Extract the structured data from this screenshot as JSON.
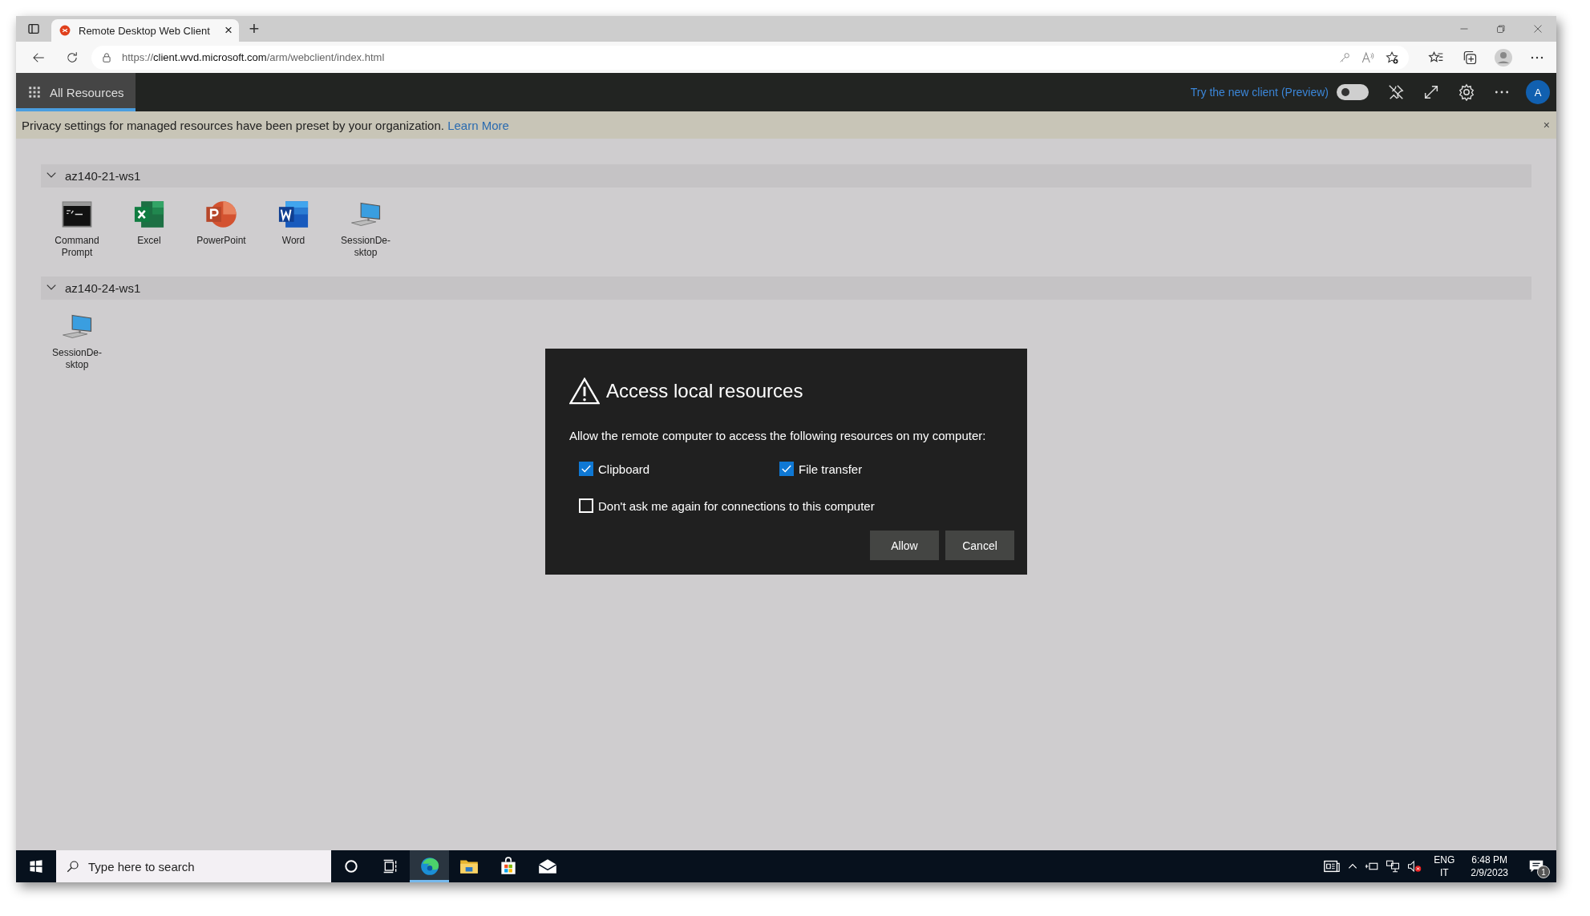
{
  "browser": {
    "tab": {
      "title": "Remote Desktop Web Client",
      "close": "×",
      "selected": true
    },
    "new_tab": "+",
    "address": {
      "scheme": "https://",
      "host": "client.wvd.microsoft.com",
      "path": "/arm/webclient/index.html"
    }
  },
  "app_bar": {
    "tabs": [
      {
        "label": "All Resources",
        "selected": true
      }
    ],
    "preview_link": "Try the new client (Preview)",
    "preview_toggle": {
      "on": false
    },
    "avatar": "A"
  },
  "banner": {
    "text": "Privacy settings for managed resources have been preset by your organization.",
    "link": "Learn More",
    "close": "×"
  },
  "groups": [
    {
      "name": "az140-21-ws1",
      "expanded": true,
      "apps": [
        {
          "name": "Command Prompt",
          "kind": "cmd"
        },
        {
          "name": "Excel",
          "kind": "excel"
        },
        {
          "name": "PowerPoint",
          "kind": "powerpoint"
        },
        {
          "name": "Word",
          "kind": "word"
        },
        {
          "name": "SessionDe-sktop",
          "kind": "desktop"
        }
      ]
    },
    {
      "name": "az140-24-ws1",
      "expanded": true,
      "apps": [
        {
          "name": "SessionDe-sktop",
          "kind": "desktop"
        }
      ]
    }
  ],
  "dialog": {
    "title": "Access local resources",
    "message": "Allow the remote computer to access the following resources on my computer:",
    "options": [
      {
        "label": "Clipboard",
        "checked": true
      },
      {
        "label": "File transfer",
        "checked": true
      }
    ],
    "remember": {
      "label": "Don't ask me again for connections to this computer",
      "checked": false
    },
    "buttons": [
      "Allow",
      "Cancel"
    ]
  },
  "taskbar": {
    "search": {
      "placeholder": "Type here to search"
    },
    "apps": [
      {
        "kind": "edge",
        "selected": true
      },
      {
        "kind": "explorer",
        "selected": false
      },
      {
        "kind": "store",
        "selected": false
      },
      {
        "kind": "mail",
        "selected": false
      }
    ],
    "language": "ENG",
    "layout": "IT",
    "time": "6:48 PM",
    "date": "2/9/2023",
    "notifications": "1"
  }
}
